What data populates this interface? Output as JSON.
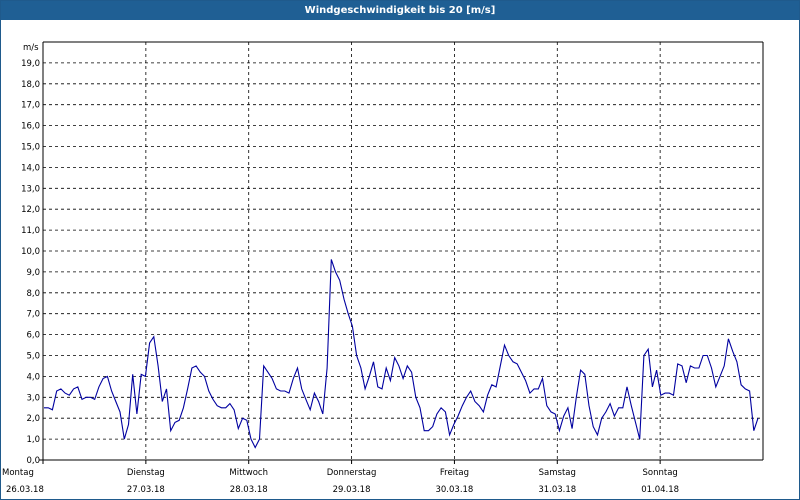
{
  "window": {
    "title": "Windgeschwindigkeit bis 20 [m/s]"
  },
  "chart_data": {
    "type": "line",
    "title": "Windgeschwindigkeit bis 20 [m/s]",
    "ylabel": "m/s",
    "ylim": [
      0,
      20
    ],
    "y_ticks": [
      "0,0",
      "1,0",
      "2,0",
      "3,0",
      "4,0",
      "5,0",
      "6,0",
      "7,0",
      "8,0",
      "9,0",
      "10,0",
      "11,0",
      "12,0",
      "13,0",
      "14,0",
      "15,0",
      "16,0",
      "17,0",
      "18,0",
      "19,0"
    ],
    "x_ticks": [
      {
        "day": "Montag",
        "date": "26.03.18"
      },
      {
        "day": "Dienstag",
        "date": "27.03.18"
      },
      {
        "day": "Mittwoch",
        "date": "28.03.18"
      },
      {
        "day": "Donnerstag",
        "date": "29.03.18"
      },
      {
        "day": "Freitag",
        "date": "30.03.18"
      },
      {
        "day": "Samstag",
        "date": "31.03.18"
      },
      {
        "day": "Sonntag",
        "date": "01.04.18"
      }
    ],
    "grid": true,
    "line_color": "#0000a0",
    "series": [
      {
        "values": [
          2.5,
          2.5,
          2.4,
          3.3,
          3.4,
          3.2,
          3.1,
          3.4,
          3.5,
          2.9,
          3.0,
          3.0,
          2.9,
          3.5,
          3.9,
          4.0,
          3.3,
          2.8,
          2.3,
          1.0,
          1.7,
          4.1,
          2.2,
          4.1,
          4.0,
          5.6,
          5.9,
          4.5,
          2.8,
          3.4,
          1.4,
          1.8,
          1.9,
          2.5,
          3.4,
          4.4,
          4.5,
          4.2,
          4.0,
          3.3,
          2.9,
          2.6,
          2.5,
          2.5,
          2.7,
          2.4,
          1.5,
          2.0,
          1.9,
          1.0,
          0.6,
          1.0,
          4.5,
          4.2,
          3.9,
          3.4,
          3.3,
          3.3,
          3.2,
          3.9,
          4.4,
          3.4,
          2.9,
          2.4,
          3.2,
          2.8,
          2.2,
          4.4,
          9.6,
          9.0,
          8.6,
          7.7,
          7.0,
          6.4,
          5.0,
          4.4,
          3.4,
          4.0,
          4.7,
          3.5,
          3.4,
          4.4,
          3.8,
          4.9,
          4.5,
          3.9,
          4.5,
          4.2,
          3.0,
          2.5,
          1.4,
          1.4,
          1.6,
          2.2,
          2.5,
          2.3,
          1.2,
          1.7,
          2.1,
          2.6,
          3.0,
          3.3,
          2.8,
          2.6,
          2.3,
          3.1,
          3.6,
          3.5,
          4.5,
          5.5,
          5.0,
          4.7,
          4.6,
          4.2,
          3.8,
          3.2,
          3.4,
          3.4,
          3.9,
          2.6,
          2.3,
          2.2,
          1.4,
          2.1,
          2.5,
          1.5,
          3.0,
          4.3,
          4.1,
          2.6,
          1.6,
          1.2,
          2.0,
          2.3,
          2.7,
          2.1,
          2.5,
          2.5,
          3.5,
          2.6,
          1.8,
          1.0,
          5.0,
          5.3,
          3.5,
          4.3,
          3.1,
          3.2,
          3.2,
          3.1,
          4.6,
          4.5,
          3.7,
          4.5,
          4.4,
          4.4,
          5.0,
          5.0,
          4.4,
          3.5,
          4.0,
          4.5,
          5.8,
          5.2,
          4.7,
          3.6,
          3.4,
          3.3,
          1.4,
          2.0
        ]
      }
    ]
  }
}
